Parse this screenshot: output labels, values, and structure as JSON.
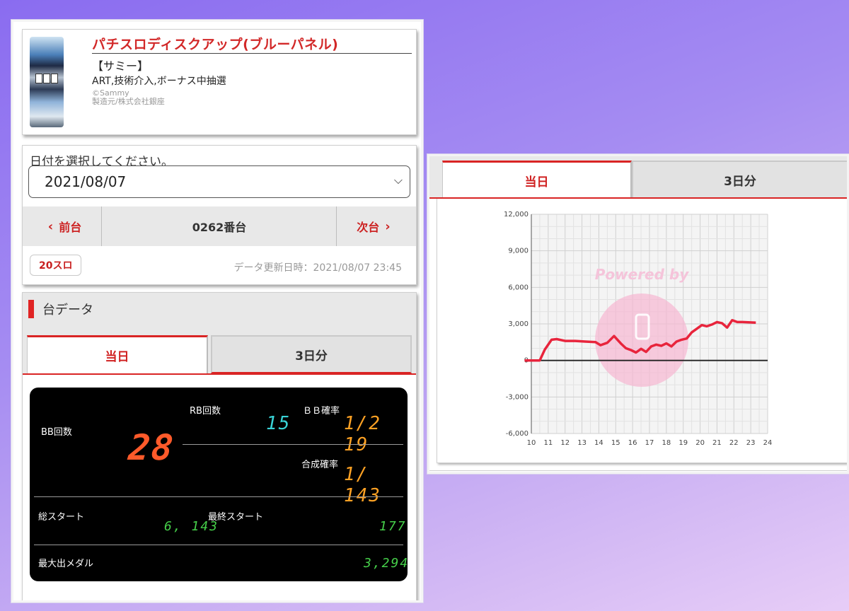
{
  "machine": {
    "title": "パチスロディスクアップ(ブルーパネル)",
    "maker": "【サミー】",
    "features": "ART,技術介入,ボーナス中抽選",
    "copyright_line1": "©Sammy",
    "copyright_line2": "製造元/株式会社銀座"
  },
  "date_section": {
    "prompt": "日付を選択してください。",
    "selected_date": "2021/08/07",
    "prev_label": "前台",
    "machine_number": "0262番台",
    "next_label": "次台",
    "rate_badge": "20スロ",
    "updated": "データ更新日時：2021/08/07 23:45"
  },
  "data_section": {
    "heading": "台データ",
    "tab_today": "当日",
    "tab_3days": "3日分"
  },
  "lcd": {
    "bb_label": "BB回数",
    "bb_value": "28",
    "rb_label": "RB回数",
    "rb_value": "15",
    "bb_rate_label": "ＢＢ確率",
    "bb_rate_value": "1/2 19",
    "combined_rate_label": "合成確率",
    "combined_rate_value": "1/ 143",
    "total_start_label": "総スタート",
    "total_start_value": "6, 143",
    "last_start_label": "最終スタート",
    "last_start_value": "177",
    "max_medal_label": "最大出メダル",
    "max_medal_value": "3,294"
  },
  "graph_tabs": {
    "tab_today": "当日",
    "tab_3days": "3日分"
  },
  "watermark": {
    "text": "Powered by"
  },
  "colors": {
    "accent_red": "#d92424",
    "lcd_red": "#ff5a2a",
    "lcd_cyan": "#39d2d6",
    "lcd_orange": "#ffa224",
    "lcd_green": "#46d04a",
    "line_red": "#e8243c"
  },
  "chart_data": {
    "type": "line",
    "title": "",
    "xlabel": "",
    "ylabel": "",
    "x_ticks": [
      "10",
      "11",
      "12",
      "13",
      "14",
      "15",
      "16",
      "17",
      "18",
      "19",
      "20",
      "21",
      "22",
      "23",
      "24"
    ],
    "y_ticks": [
      "12,000",
      "9,000",
      "6,000",
      "3,000",
      "0",
      "-3,000",
      "-6,000"
    ],
    "xlim": [
      10,
      24
    ],
    "ylim": [
      -6000,
      12000
    ],
    "grid": true,
    "series": [
      {
        "x": [
          9.6,
          10.5,
          10.8,
          11.2,
          11.5,
          12.0,
          12.6,
          13.2,
          13.8,
          14.1,
          14.5,
          14.9,
          15.3,
          15.6,
          15.9,
          16.2,
          16.5,
          16.8,
          17.1,
          17.4,
          17.7,
          18.0,
          18.3,
          18.6,
          18.9,
          19.2,
          19.5,
          19.8,
          20.1,
          20.4,
          20.7,
          21.0,
          21.3,
          21.6,
          21.9,
          22.2,
          22.5,
          23.3
        ],
        "y": [
          0,
          0,
          900,
          1700,
          1750,
          1600,
          1600,
          1550,
          1500,
          1250,
          1450,
          2000,
          1400,
          1000,
          850,
          650,
          950,
          700,
          1150,
          1300,
          1200,
          1400,
          1150,
          1550,
          1700,
          1800,
          2300,
          2600,
          2900,
          2800,
          2950,
          3150,
          3050,
          2700,
          3300,
          3150,
          3150,
          3100
        ]
      }
    ]
  }
}
